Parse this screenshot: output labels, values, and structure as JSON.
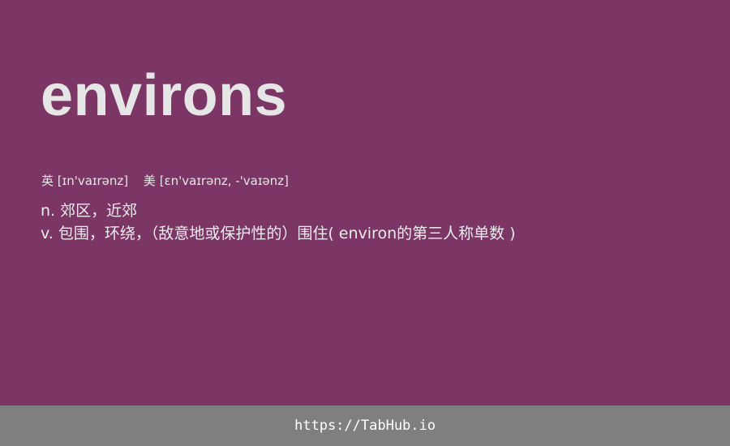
{
  "word": "environs",
  "pronunciation": {
    "uk": {
      "label": "英",
      "ipa": "[ɪn'vaɪrənz]"
    },
    "us": {
      "label": "美",
      "ipa": "[ɛn'vaɪrənz, -'vaɪənz]"
    }
  },
  "definitions": [
    "n. 郊区，近郊",
    "v. 包围，环绕，（敌意地或保护性的）围住( environ的第三人称单数 )"
  ],
  "footer": {
    "url": "https://TabHub.io"
  },
  "colors": {
    "card_background": "#7b3666",
    "footer_background": "#7f7f7f",
    "text": "#e6e6e6"
  }
}
